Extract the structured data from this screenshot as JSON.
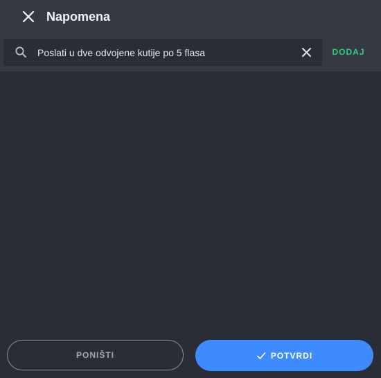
{
  "header": {
    "title": "Napomena",
    "close_icon": "close-icon"
  },
  "search": {
    "value": "Poslati u dve odvojene kutije po 5 flasa",
    "search_icon": "search-icon",
    "clear_icon": "clear-icon"
  },
  "toolbar": {
    "add_label": "DODAJ"
  },
  "footer": {
    "cancel_label": "PONIŠTI",
    "confirm_label": "POTVRDI",
    "confirm_icon": "check-icon"
  },
  "colors": {
    "background": "#2a2d36",
    "header": "#353944",
    "accent_green": "#2fd17a",
    "accent_blue": "#3e8bff"
  }
}
